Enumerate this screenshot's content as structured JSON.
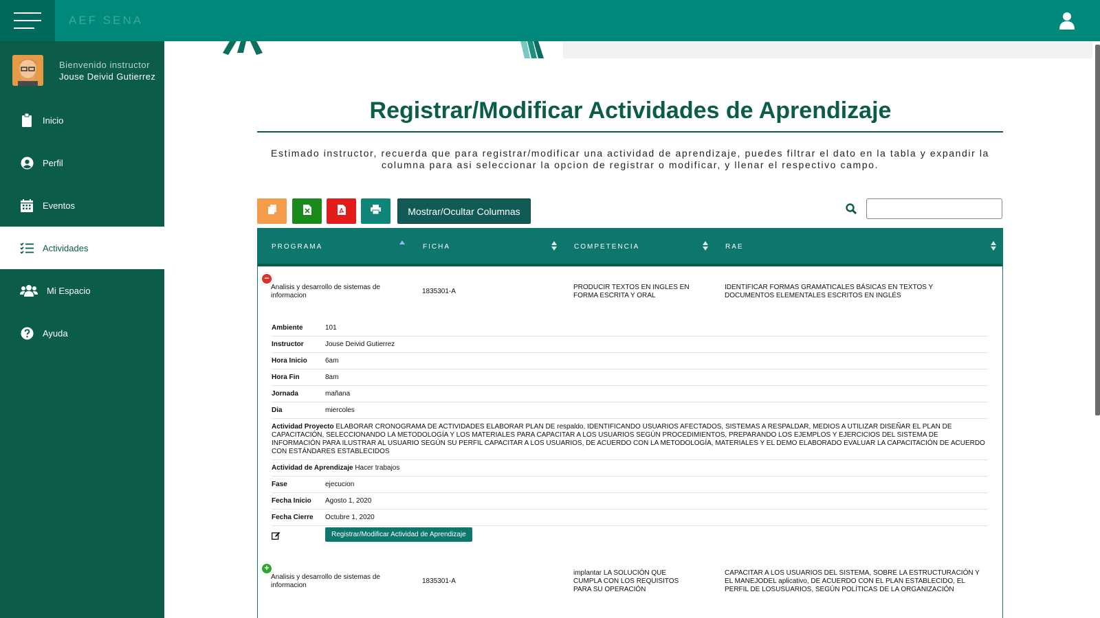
{
  "header": {
    "brand": "AEF SENA"
  },
  "sidebar": {
    "welcome": "Bienvenido instructor",
    "user_name": "Jouse Deivid Gutierrez",
    "items": [
      {
        "label": "Inicio",
        "icon": "clipboard-icon"
      },
      {
        "label": "Perfil",
        "icon": "user-circle-icon"
      },
      {
        "label": "Eventos",
        "icon": "calendar-icon"
      },
      {
        "label": "Actividades",
        "icon": "task-list-icon",
        "active": true
      },
      {
        "label": "Mi Espacio",
        "icon": "users-icon"
      },
      {
        "label": "Ayuda",
        "icon": "help-icon"
      }
    ]
  },
  "main": {
    "title": "Registrar/Modificar Actividades de Aprendizaje",
    "intro": "Estimado instructor, recuerda que para registrar/modificar una actividad de aprendizaje, puedes filtrar el dato en la tabla y expandir la columna para asi seleccionar la opcion de registrar o modificar, y llenar el respectivo campo.",
    "toolbar": {
      "columns_button": "Mostrar/Ocultar Columnas",
      "buttons": [
        {
          "icon": "copy-icon",
          "color": "#f39c4a"
        },
        {
          "icon": "excel-icon",
          "color": "#198a1c"
        },
        {
          "icon": "pdf-icon",
          "color": "#e31b1b"
        },
        {
          "icon": "print-icon",
          "color": "#0d8577"
        }
      ],
      "search_placeholder": ""
    },
    "table": {
      "headers": [
        "PROGRAMA",
        "FICHA",
        "COMPETENCIA",
        "RAE"
      ],
      "rows": [
        {
          "programa": "Analisis y desarrollo de sistemas de informacion",
          "ficha": "1835301-A",
          "competencia": "PRODUCIR TEXTOS EN INGLES EN FORMA ESCRITA Y ORAL",
          "rae": "IDENTIFICAR FORMAS GRAMATICALES BÁSICAS EN TEXTOS Y DOCUMENTOS ELEMENTALES ESCRITOS EN INGLÉS",
          "expanded": true
        },
        {
          "programa": "Analisis y desarrollo de sistemas de informacion",
          "ficha": "1835301-A",
          "competencia": "implantar LA SOLUCIÓN QUE CUMPLA CON LOS REQUISITOS PARA SU OPERACIÓN",
          "rae": "CAPACITAR A LOS USUARIOS DEL SISTEMA, SOBRE LA ESTRUCTURACIÓN Y EL MANEJODEL aplicativo, DE ACUERDO CON EL PLAN ESTABLECIDO, EL PERFIL DE LOSUSUARIOS, SEGÚN POLÍTICAS DE LA ORGANIZACIÓN",
          "expanded": false
        }
      ],
      "detail": {
        "ambiente_label": "Ambiente",
        "ambiente": "101",
        "instructor_label": "Instructor",
        "instructor": "Jouse Deivid Gutierrez",
        "hora_inicio_label": "Hora Inicio",
        "hora_inicio": "6am",
        "hora_fin_label": "Hora Fin",
        "hora_fin": "8am",
        "jornada_label": "Jornada",
        "jornada": "mañana",
        "dia_label": "Dia",
        "dia": "miercoles",
        "actividad_proyecto_label": "Actividad Proyecto",
        "actividad_proyecto": "ELABORAR CRONOGRAMA DE ACTIVIDADES ELABORAR PLAN DE respaldo, IDENTIFICANDO USUARIOS AFECTADOS, SISTEMAS A RESPALDAR, MEDIOS A UTILIZAR DISEÑAR EL PLAN DE CAPACITACIÓN, SELECCIONANDO LA METODOLOGÍA Y LOS MATERIALES PARA CAPACITAR A LOS USUARIOS SEGÚN PROCEDIMIENTOS, PREPARANDO LOS EJEMPLOS Y EJERCICIOS DEL SISTEMA DE INFORMACIÓN PARA ILUSTRAR AL USUARIO SEGÚN SU PERFIL CAPACITAR A LOS USUARIOS, DE ACUERDO CON LA METODOLOGÍA, MATERIALES Y EL DEMO ELABORADO EVALUAR LA CAPACITACIÓN DE ACUERDO CON ESTÁNDARES ESTABLECIDOS",
        "actividad_aprendizaje_label": "Actividad de Aprendizaje",
        "actividad_aprendizaje": "Hacer trabajos",
        "fase_label": "Fase",
        "fase": "ejecucion",
        "fecha_inicio_label": "Fecha Inicio",
        "fecha_inicio": "Agosto 1, 2020",
        "fecha_cierre_label": "Fecha Cierre",
        "fecha_cierre": "Octubre 1, 2020",
        "register_button": "Registrar/Modificar Actividad de Aprendizaje"
      }
    }
  },
  "colors": {
    "primary": "#00897b",
    "dark": "#0b5c48",
    "header": "#0d776e"
  }
}
